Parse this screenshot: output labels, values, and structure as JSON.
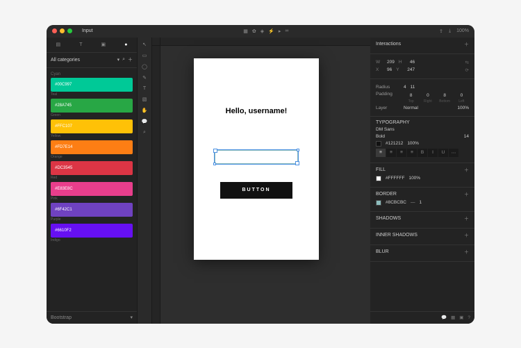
{
  "titlebar": {
    "title": "Input",
    "zoom": "100%"
  },
  "leftPanel": {
    "filterLabel": "All categories",
    "groupLabel": "Cyan",
    "footer": "Bootstrap",
    "swatches": [
      {
        "label": "#00C997",
        "sub": "Teal",
        "color": "#00c997"
      },
      {
        "label": "#28A745",
        "sub": "Green",
        "color": "#28a745"
      },
      {
        "label": "#FFC107",
        "sub": "Yellow",
        "color": "#ffc107"
      },
      {
        "label": "#FD7E14",
        "sub": "Orange",
        "color": "#fd7e14"
      },
      {
        "label": "#DC3545",
        "sub": "Red",
        "color": "#dc3545"
      },
      {
        "label": "#E83E8C",
        "sub": "Pink",
        "color": "#e83e8c"
      },
      {
        "label": "#6F42C1",
        "sub": "Purple",
        "color": "#6f42c1"
      },
      {
        "label": "#6610F2",
        "sub": "Indigo",
        "color": "#6610f2"
      }
    ]
  },
  "artboard": {
    "greeting": "Hello, username!",
    "buttonLabel": "BUTTON"
  },
  "rightPanel": {
    "interactions": {
      "header": "Interactions"
    },
    "dimensions": {
      "w": "209",
      "h": "46",
      "x": "96",
      "y": "247"
    },
    "radius": {
      "label": "Radius",
      "a": "4",
      "b": "11"
    },
    "padding": {
      "label": "Padding",
      "t": "8",
      "r": "0",
      "b": "8",
      "l": "0",
      "lbls": [
        "Top",
        "Right",
        "Bottom",
        "Left"
      ]
    },
    "layer": {
      "label": "Layer",
      "blend": "Normal",
      "opacity": "100%"
    },
    "typography": {
      "header": "TYPOGRAPHY",
      "font": "DM Sans",
      "weight": "Bold",
      "size": "14",
      "color": "#121212",
      "opacity": "100%"
    },
    "fill": {
      "header": "FILL",
      "color": "#FFFFFF",
      "opacity": "100%"
    },
    "border": {
      "header": "BORDER",
      "color": "#8CBCBC",
      "width": "1"
    },
    "shadows": "SHADOWS",
    "innerShadows": "INNER SHADOWS",
    "blur": "BLUR"
  }
}
